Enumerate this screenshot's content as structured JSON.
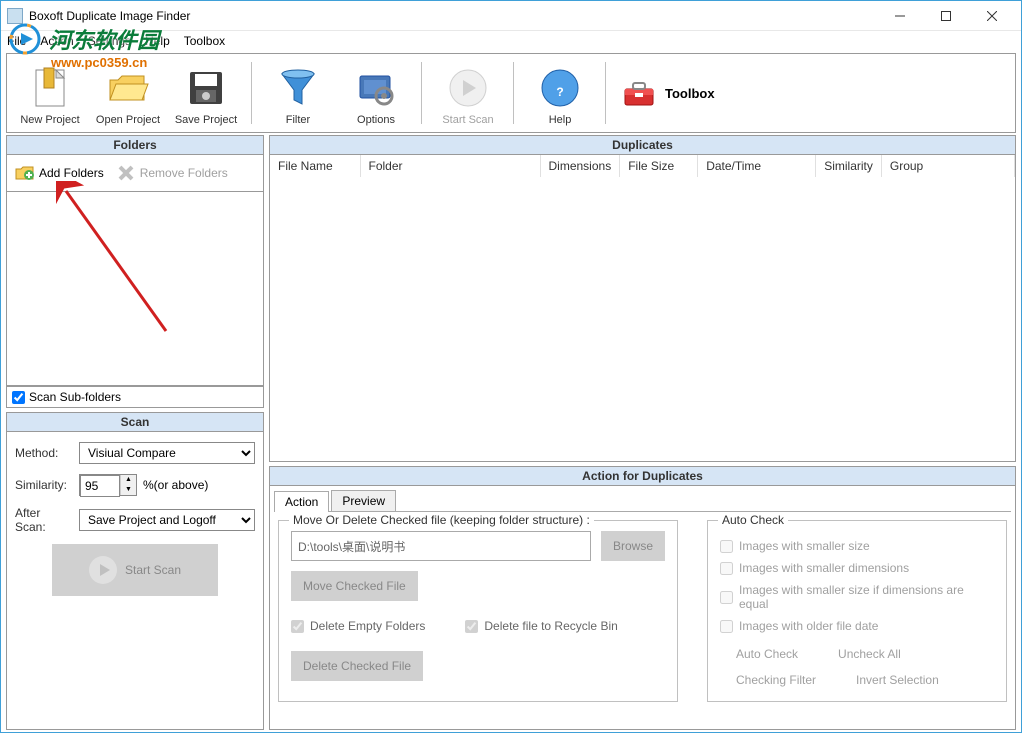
{
  "window": {
    "title": "Boxoft Duplicate Image Finder"
  },
  "menu": {
    "file": "File",
    "action": "Action",
    "settings": "Settings",
    "help": "Help",
    "toolbox": "Toolbox"
  },
  "toolbar": {
    "new_project": "New Project",
    "open_project": "Open Project",
    "save_project": "Save Project",
    "filter": "Filter",
    "options": "Options",
    "start_scan": "Start Scan",
    "help": "Help",
    "toolbox": "Toolbox"
  },
  "folders_panel": {
    "header": "Folders",
    "add_folders": "Add Folders",
    "remove_folders": "Remove Folders",
    "scan_subfolders": "Scan Sub-folders"
  },
  "scan_panel": {
    "header": "Scan",
    "method_label": "Method:",
    "method_value": "Visiual Compare",
    "similarity_label": "Similarity:",
    "similarity_value": "95",
    "similarity_suffix": "%(or above)",
    "after_scan_label": "After Scan:",
    "after_scan_value": "Save Project and Logoff",
    "start_scan_btn": "Start Scan"
  },
  "duplicates_panel": {
    "header": "Duplicates",
    "columns": {
      "file_name": "File Name",
      "folder": "Folder",
      "dimensions": "Dimensions",
      "file_size": "File Size",
      "date_time": "Date/Time",
      "similarity": "Similarity",
      "group": "Group"
    }
  },
  "action_panel": {
    "header": "Action for Duplicates",
    "tabs": {
      "action": "Action",
      "preview": "Preview"
    },
    "move_legend": "Move Or Delete Checked file (keeping folder structure) :",
    "path_value": "D:\\tools\\桌面\\说明书",
    "browse": "Browse",
    "move_checked": "Move Checked File",
    "delete_empty": "Delete Empty Folders",
    "delete_recycle": "Delete file to Recycle Bin",
    "delete_checked": "Delete Checked File",
    "auto_legend": "Auto Check",
    "auto_smaller_size": "Images with smaller size",
    "auto_smaller_dim": "Images with smaller dimensions",
    "auto_smaller_eq": "Images with smaller size if dimensions are equal",
    "auto_older": "Images with older file date",
    "link_autocheck": "Auto Check",
    "link_uncheck": "Uncheck All",
    "link_filter": "Checking Filter",
    "link_invert": "Invert Selection"
  },
  "watermark": {
    "text": "河东软件园",
    "url": "www.pc0359.cn"
  }
}
